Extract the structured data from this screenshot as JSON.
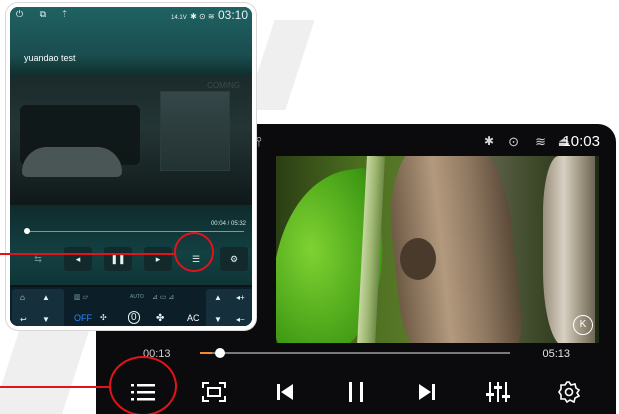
{
  "big": {
    "status": {
      "time": "10:03",
      "icons": [
        "bluetooth-icon",
        "location-icon",
        "wifi-icon",
        "eject-icon"
      ]
    },
    "player": {
      "current_time": "00:13",
      "duration": "05:13",
      "progress": 0.04
    },
    "controls": [
      "playlist-icon",
      "fullscreen-icon",
      "previous-icon",
      "pause-icon",
      "next-icon",
      "equalizer-icon",
      "settings-icon"
    ],
    "watermark": "K"
  },
  "small": {
    "status": {
      "time": "03:10",
      "battery_text": "14.1V"
    },
    "title": "yuandao test",
    "video_watermark": "COMING",
    "player": {
      "time": "00:04 / 05:32",
      "progress": 0.01
    },
    "climate": {
      "off": "OFF",
      "ac": "AC",
      "auto": "AUTO",
      "temp": "0"
    }
  },
  "colors": {
    "accent": "#e0141b",
    "progress": "#f08a2a",
    "teal": "#1f6262"
  }
}
